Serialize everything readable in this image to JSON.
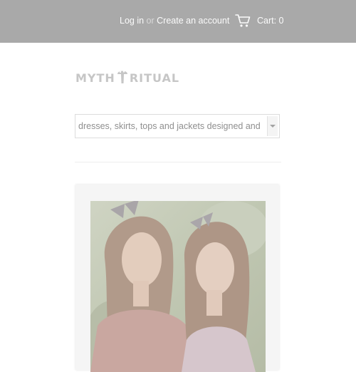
{
  "header": {
    "login_label": "Log in",
    "or_text": "or",
    "create_account_label": "Create an account",
    "cart_label": "Cart: 0",
    "cart_icon": "shopping-cart-icon"
  },
  "logo": {
    "left_text": "MYTH",
    "right_text": "RITUAL",
    "icon": "mushroom-icon"
  },
  "catalog_select": {
    "value": "dresses, skirts, tops and jackets designed and"
  },
  "hero": {
    "image": "two-women-portrait-photo"
  },
  "colors": {
    "topbar": "#a9a9a9",
    "header_text": "#fbfbfb",
    "logo": "#c6c6c6"
  }
}
